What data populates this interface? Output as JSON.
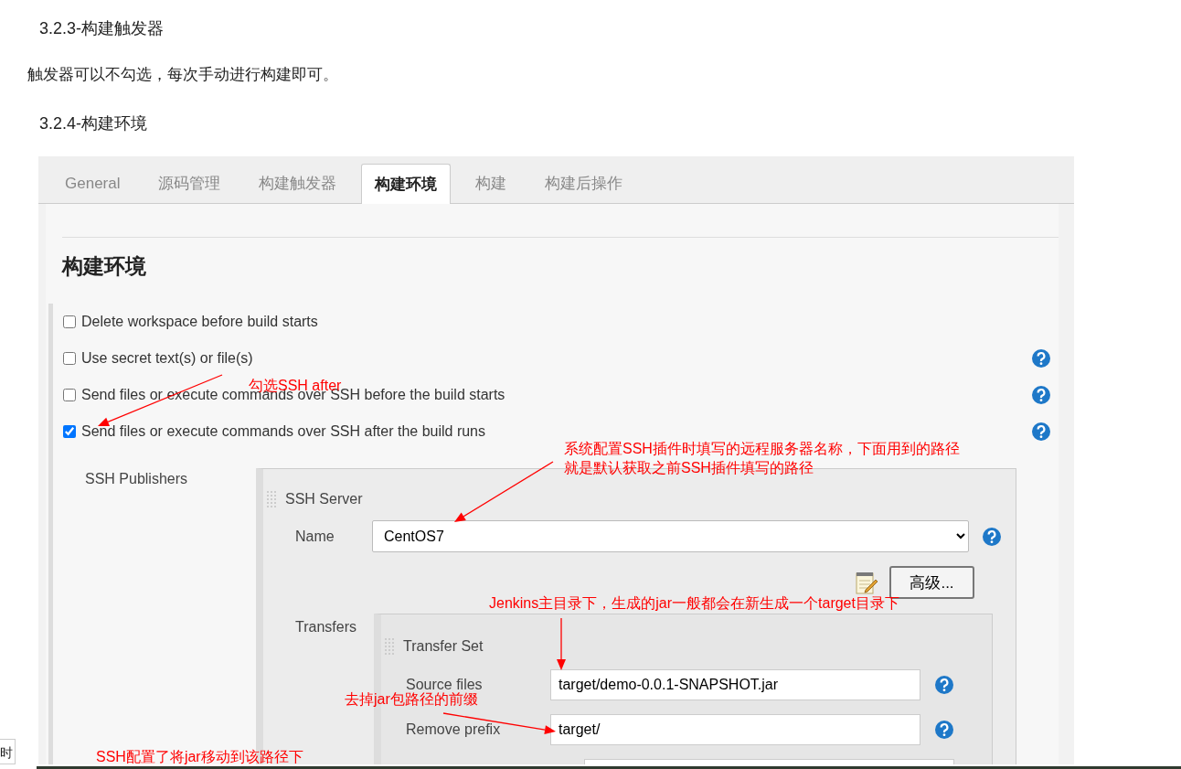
{
  "article": [
    {
      "kind": "heading",
      "text": "3.2.3-构建触发器"
    },
    {
      "kind": "paragraph",
      "text": "触发器可以不勾选，每次手动进行构建即可。"
    },
    {
      "kind": "heading",
      "text": "3.2.4-构建环境"
    }
  ],
  "screenshot": {
    "tabs": [
      {
        "label": "General",
        "selected": false
      },
      {
        "label": "源码管理",
        "selected": false
      },
      {
        "label": "构建触发器",
        "selected": false
      },
      {
        "label": "构建环境",
        "selected": true
      },
      {
        "label": "构建",
        "selected": false
      },
      {
        "label": "构建后操作",
        "selected": false
      }
    ],
    "section_title": "构建环境",
    "options": [
      {
        "label": "Delete workspace before build starts",
        "checked": false,
        "help": false
      },
      {
        "label": "Use secret text(s) or file(s)",
        "checked": false,
        "help": true
      },
      {
        "label": "Send files or execute commands over SSH before the build starts",
        "checked": false,
        "help": true
      },
      {
        "label": "Send files or execute commands over SSH after the build runs",
        "checked": true,
        "help": true
      }
    ],
    "ssh_publishers": {
      "label": "SSH Publishers",
      "server_label": "SSH Server",
      "name_label": "Name",
      "name_value": "CentOS7",
      "advanced_button": "高级...",
      "transfers_label": "Transfers",
      "transfer_set_label": "Transfer Set",
      "fields": [
        {
          "label": "Source files",
          "value": "target/demo-0.0.1-SNAPSHOT.jar"
        },
        {
          "label": "Remove prefix",
          "value": "target/"
        }
      ],
      "partial_field": true
    },
    "annotations": [
      {
        "lines": [
          "勾选SSH after"
        ]
      },
      {
        "lines": [
          "系统配置SSH插件时填写的远程服务器名称，下面用到的路径",
          "就是默认获取之前SSH插件填写的路径"
        ]
      },
      {
        "lines": [
          "Jenkins主目录下，生成的jar一般都会在新生成一个target目录下"
        ]
      },
      {
        "lines": [
          "去掉jar包路径的前缀"
        ]
      },
      {
        "lines": [
          "SSH配置了将jar移动到该路径下"
        ]
      }
    ]
  },
  "side_tab": "时"
}
